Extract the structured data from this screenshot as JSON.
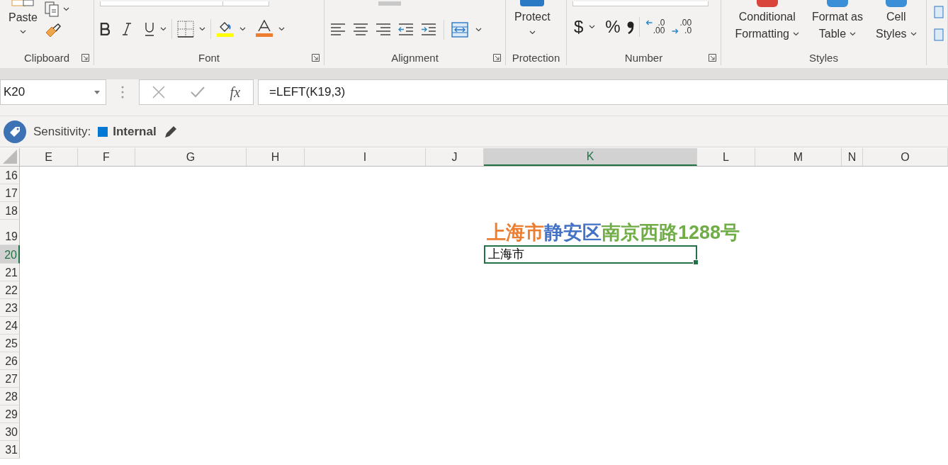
{
  "ribbon": {
    "groups": [
      {
        "kind": "clipboard",
        "label": "Clipboard",
        "launcher": true,
        "big_button": {
          "label": "Paste"
        }
      },
      {
        "kind": "font",
        "label": "Font",
        "launcher": true
      },
      {
        "kind": "alignment",
        "label": "Alignment",
        "launcher": true
      },
      {
        "kind": "protection",
        "label": "Protection",
        "launcher": false,
        "big_button": {
          "label": "Protect"
        }
      },
      {
        "kind": "number",
        "label": "Number",
        "launcher": true,
        "symbols": [
          "$",
          "%"
        ],
        "decimals": [
          {
            "upper": ".0",
            "lower": ".00",
            "kind": "increase"
          },
          {
            "upper": ".00",
            "lower": ".0",
            "kind": "decrease"
          }
        ]
      },
      {
        "kind": "styles",
        "label": "Styles",
        "launcher": false,
        "buttons": [
          {
            "lines": [
              "Conditional",
              "Formatting"
            ]
          },
          {
            "lines": [
              "Format as",
              "Table"
            ]
          },
          {
            "lines": [
              "Cell",
              "Styles"
            ]
          }
        ]
      },
      {
        "kind": "cells"
      }
    ]
  },
  "formula_bar": {
    "name_box": "K20",
    "function_label": "fx",
    "formula": "=LEFT(K19,3)"
  },
  "sensitivity": {
    "label": "Sensitivity:",
    "value": "Internal"
  },
  "sheet": {
    "columns": [
      {
        "label": "E",
        "selected": false
      },
      {
        "label": "F",
        "selected": false
      },
      {
        "label": "G",
        "selected": false
      },
      {
        "label": "H",
        "selected": false
      },
      {
        "label": "I",
        "selected": false
      },
      {
        "label": "J",
        "selected": false
      },
      {
        "label": "K",
        "selected": true
      },
      {
        "label": "L",
        "selected": false
      },
      {
        "label": "M",
        "selected": false
      },
      {
        "label": "N",
        "selected": false
      },
      {
        "label": "O",
        "selected": false
      }
    ],
    "rows": [
      {
        "label": "16",
        "selected": false
      },
      {
        "label": "17",
        "selected": false
      },
      {
        "label": "18",
        "selected": false
      },
      {
        "label": "19",
        "selected": false,
        "cells": [
          null,
          null,
          null,
          null,
          null,
          null,
          {
            "selected": false,
            "bold": true,
            "segments": [
              {
                "text": "上海市",
                "color": "#ed7d31"
              },
              {
                "text": "静安区",
                "color": "#4472c4"
              },
              {
                "text": "南京西路1288号",
                "color": "#70ad47"
              }
            ]
          },
          null,
          null,
          null,
          null
        ]
      },
      {
        "label": "20",
        "selected": true,
        "cells": [
          null,
          null,
          null,
          null,
          null,
          null,
          {
            "selected": true,
            "bold": false,
            "segments": [
              {
                "text": "上海市",
                "color": "#000000"
              }
            ]
          },
          null,
          null,
          null,
          null
        ]
      },
      {
        "label": "21",
        "selected": false
      },
      {
        "label": "22",
        "selected": false
      },
      {
        "label": "23",
        "selected": false
      },
      {
        "label": "24",
        "selected": false
      },
      {
        "label": "25",
        "selected": false
      },
      {
        "label": "26",
        "selected": false
      },
      {
        "label": "27",
        "selected": false
      },
      {
        "label": "28",
        "selected": false
      },
      {
        "label": "29",
        "selected": false
      },
      {
        "label": "30",
        "selected": false
      },
      {
        "label": "31",
        "selected": false
      }
    ]
  }
}
